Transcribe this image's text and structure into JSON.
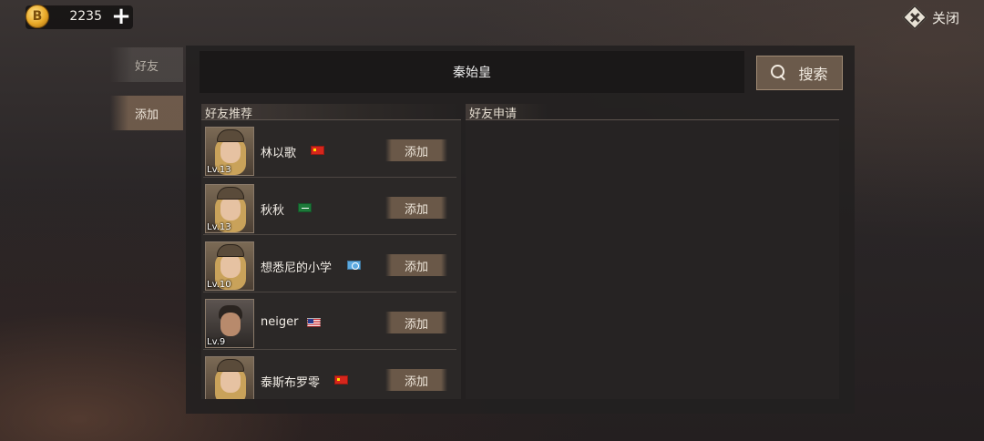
{
  "topbar": {
    "coin_icon": "coin-icon",
    "coin_symbol": "B",
    "coin_value": "2235",
    "plus_symbol": "+",
    "close_label": "关闭"
  },
  "sidebar": {
    "tabs": [
      {
        "label": "好友",
        "active": false
      },
      {
        "label": "添加",
        "active": true
      }
    ]
  },
  "search": {
    "value": "秦始皇",
    "button_label": "搜索"
  },
  "recommend": {
    "title": "好友推荐",
    "add_label": "添加",
    "friends": [
      {
        "name": "林以歌",
        "level": "Lv.13",
        "flag": "cn",
        "avatar": "female-soldier-avatar"
      },
      {
        "name": "秋秋",
        "level": "Lv.13",
        "flag": "sa",
        "avatar": "female-soldier-avatar"
      },
      {
        "name": "想悉尼的小学",
        "level": "Lv.10",
        "flag": "un",
        "avatar": "female-soldier-avatar"
      },
      {
        "name": "neiger",
        "level": "Lv.9",
        "flag": "us",
        "avatar": "male-soldier-avatar"
      },
      {
        "name": "泰斯布罗零",
        "level": "",
        "flag": "cn",
        "avatar": "female-soldier-avatar"
      }
    ]
  },
  "requests": {
    "title": "好友申请"
  },
  "colors": {
    "accent": "#6b5a4b",
    "panel": "#222020",
    "text": "#e8e2d6"
  }
}
